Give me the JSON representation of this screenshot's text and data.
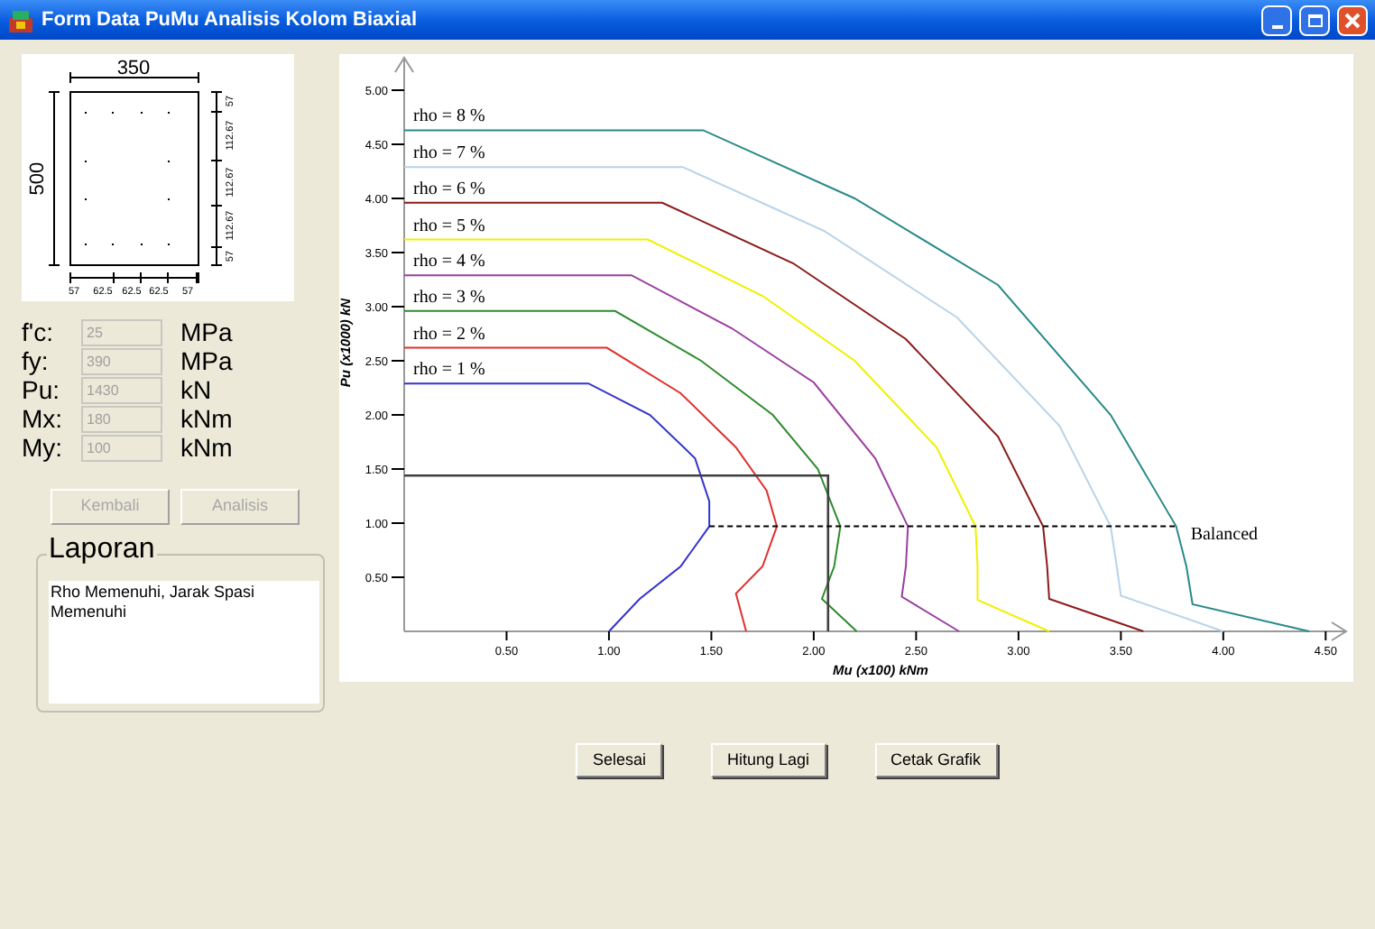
{
  "window": {
    "title": "Form Data PuMu Analisis Kolom Biaxial"
  },
  "section": {
    "width_label": "350",
    "height_label": "500",
    "bottom_dims": [
      "57",
      "62.5",
      "62.5",
      "62.5",
      "57"
    ],
    "side_dims": [
      "57",
      "112.67",
      "112.67",
      "112.67",
      "57"
    ]
  },
  "fields": [
    {
      "label": "f'c:",
      "value": "25",
      "unit": "MPa",
      "disabled": true
    },
    {
      "label": "fy:",
      "value": "390",
      "unit": "MPa",
      "disabled": true
    },
    {
      "label": "Pu:",
      "value": "1430",
      "unit": "kN",
      "disabled": true
    },
    {
      "label": "Mx:",
      "value": "180",
      "unit": "kNm",
      "disabled": true
    },
    {
      "label": "My:",
      "value": "100",
      "unit": "kNm",
      "disabled": true
    }
  ],
  "buttons": [
    {
      "label": "Kembali",
      "disabled": true
    },
    {
      "label": "Analisis",
      "disabled": true
    }
  ],
  "report": {
    "title": "Laporan",
    "text": "Rho Memenuhi, Jarak Spasi Memenuhi"
  },
  "chart": {
    "chart_data": {
      "type": "line",
      "xlabel": "Mu (x100) kNm",
      "ylabel": "Pu (x1000) kN",
      "xlim": [
        0,
        4.6
      ],
      "ylim": [
        0,
        5.3
      ],
      "xticks": [
        {
          "value": 0.5,
          "label": "0.50"
        },
        {
          "value": 1,
          "label": "1.00"
        },
        {
          "value": 1.5,
          "label": "1.50"
        },
        {
          "value": 2,
          "label": "2.00"
        },
        {
          "value": 2.5,
          "label": "2.50"
        },
        {
          "value": 3,
          "label": "3.00"
        },
        {
          "value": 3.5,
          "label": "3.50"
        },
        {
          "value": 4,
          "label": "4.00"
        },
        {
          "value": 4.5,
          "label": "4.50"
        }
      ],
      "yticks": [
        {
          "value": 0.5,
          "label": "0.50"
        },
        {
          "value": 1,
          "label": "1.00"
        },
        {
          "value": 1.5,
          "label": "1.50"
        },
        {
          "value": 2,
          "label": "2.00"
        },
        {
          "value": 2.5,
          "label": "2.50"
        },
        {
          "value": 3,
          "label": "3.00"
        },
        {
          "value": 3.5,
          "label": "3.50"
        },
        {
          "value": 4,
          "label": "4.00"
        },
        {
          "value": 4.5,
          "label": "4.50"
        },
        {
          "value": 5,
          "label": "5.00"
        }
      ],
      "series": [
        {
          "name": "rho = 8 %",
          "color": "#2a8a8a",
          "x": [
            0,
            1.46,
            2.2,
            2.9,
            3.45,
            3.77,
            3.82,
            3.85,
            4.42
          ],
          "values": [
            4.63,
            4.63,
            4.0,
            3.2,
            2.0,
            0.97,
            0.6,
            0.25,
            0
          ]
        },
        {
          "name": "rho = 7 %",
          "color": "#b8d4e8",
          "x": [
            0,
            1.36,
            2.05,
            2.7,
            3.2,
            3.45,
            3.48,
            3.5,
            4.0
          ],
          "values": [
            4.29,
            4.29,
            3.7,
            2.9,
            1.9,
            0.97,
            0.6,
            0.33,
            0
          ]
        },
        {
          "name": "rho = 6 %",
          "color": "#8b1a1a",
          "x": [
            0,
            1.26,
            1.9,
            2.45,
            2.9,
            3.12,
            3.14,
            3.15,
            3.61
          ],
          "values": [
            3.96,
            3.96,
            3.4,
            2.7,
            1.8,
            0.97,
            0.6,
            0.3,
            0
          ]
        },
        {
          "name": "rho = 5 %",
          "color": "#f0f000",
          "x": [
            0,
            1.19,
            1.75,
            2.2,
            2.6,
            2.79,
            2.8,
            2.8,
            3.15
          ],
          "values": [
            3.62,
            3.62,
            3.1,
            2.5,
            1.7,
            0.97,
            0.6,
            0.29,
            0
          ]
        },
        {
          "name": "rho = 4 %",
          "color": "#9b3fa0",
          "x": [
            0,
            1.11,
            1.6,
            2.0,
            2.3,
            2.46,
            2.45,
            2.43,
            2.71
          ],
          "values": [
            3.29,
            3.29,
            2.8,
            2.3,
            1.6,
            0.97,
            0.6,
            0.32,
            0
          ]
        },
        {
          "name": "rho = 3 %",
          "color": "#2e8b2e",
          "x": [
            0,
            1.03,
            1.45,
            1.8,
            2.02,
            2.13,
            2.1,
            2.04,
            2.21
          ],
          "values": [
            2.96,
            2.96,
            2.5,
            2.0,
            1.5,
            0.97,
            0.6,
            0.3,
            0
          ]
        },
        {
          "name": "rho = 2 %",
          "color": "#e03030",
          "x": [
            0,
            0.99,
            1.35,
            1.62,
            1.77,
            1.82,
            1.75,
            1.62,
            1.67
          ],
          "values": [
            2.62,
            2.62,
            2.2,
            1.7,
            1.3,
            0.97,
            0.6,
            0.35,
            0
          ]
        },
        {
          "name": "rho = 1 %",
          "color": "#3333cc",
          "x": [
            0,
            0.9,
            1.2,
            1.42,
            1.49,
            1.49,
            1.35,
            1.15,
            1.0
          ],
          "values": [
            2.29,
            2.29,
            2.0,
            1.6,
            1.2,
            0.97,
            0.6,
            0.3,
            0
          ]
        },
        {
          "color": "#404040",
          "x": [
            0,
            2.07,
            2.07
          ],
          "values": [
            1.44,
            1.44,
            0
          ]
        }
      ],
      "annotations": [
        {
          "text": "Balanced",
          "x": 3.77,
          "y": 0.97
        }
      ]
    }
  },
  "footer_buttons": [
    {
      "label": "Selesai"
    },
    {
      "label": "Hitung Lagi"
    },
    {
      "label": "Cetak Grafik"
    }
  ]
}
